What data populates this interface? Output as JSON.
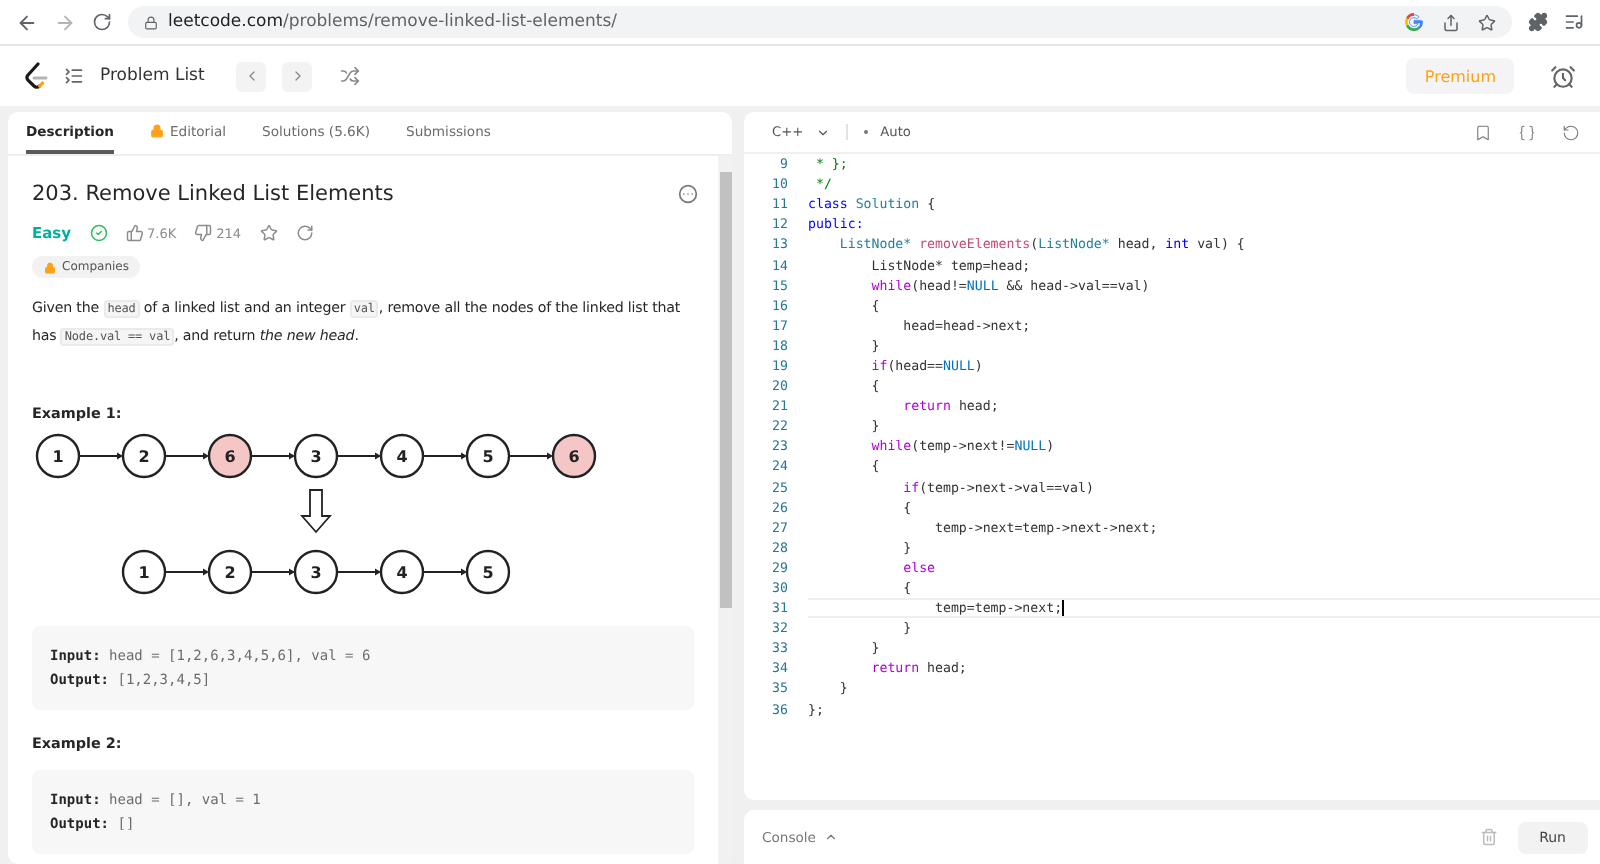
{
  "browser": {
    "url_host": "leetcode.com",
    "url_path": "/problems/remove-linked-list-elements/"
  },
  "header": {
    "title": "Problem List",
    "premium": "Premium"
  },
  "tabs": [
    {
      "label": "Description",
      "selected": true,
      "locked": false
    },
    {
      "label": "Editorial",
      "selected": false,
      "locked": true
    },
    {
      "label": "Solutions (5.6K)",
      "selected": false,
      "locked": false
    },
    {
      "label": "Submissions",
      "selected": false,
      "locked": false
    }
  ],
  "problem": {
    "title": "203. Remove Linked List Elements",
    "difficulty": "Easy",
    "solved": true,
    "likes": "7.6K",
    "dislikes": "214",
    "tag": "Companies",
    "description": [
      {
        "kind": "text",
        "text": "Given the "
      },
      {
        "kind": "code",
        "text": "head"
      },
      {
        "kind": "text",
        "text": " of a linked list and an integer "
      },
      {
        "kind": "code",
        "text": "val"
      },
      {
        "kind": "text",
        "text": ", remove all the nodes of the linked list that has "
      },
      {
        "kind": "code",
        "text": "Node.val == val"
      },
      {
        "kind": "text",
        "text": ", and return "
      },
      {
        "kind": "italic",
        "text": "the new head"
      },
      {
        "kind": "text",
        "text": "."
      }
    ],
    "examples": [
      {
        "title": "Example 1:",
        "diagram": {
          "before": [
            {
              "value": "1",
              "removed": false
            },
            {
              "value": "2",
              "removed": false
            },
            {
              "value": "6",
              "removed": true
            },
            {
              "value": "3",
              "removed": false
            },
            {
              "value": "4",
              "removed": false
            },
            {
              "value": "5",
              "removed": false
            },
            {
              "value": "6",
              "removed": true
            }
          ],
          "after": [
            {
              "value": "1",
              "removed": false
            },
            {
              "value": "2",
              "removed": false
            },
            {
              "value": "3",
              "removed": false
            },
            {
              "value": "4",
              "removed": false
            },
            {
              "value": "5",
              "removed": false
            }
          ]
        },
        "lines": [
          {
            "label": "Input:",
            "value": "head = [1,2,6,3,4,5,6], val = 6"
          },
          {
            "label": "Output:",
            "value": "[1,2,3,4,5]"
          }
        ]
      },
      {
        "title": "Example 2:",
        "lines": [
          {
            "label": "Input:",
            "value": "head = [], val = 1"
          },
          {
            "label": "Output:",
            "value": "[]"
          }
        ]
      }
    ]
  },
  "editor": {
    "language": "C++",
    "mode": "Auto",
    "lines": [
      {
        "number": "9",
        "current": false,
        "tokens": [
          {
            "kind": "comment",
            "text": " * };"
          }
        ]
      },
      {
        "number": "10",
        "current": false,
        "tokens": [
          {
            "kind": "comment",
            "text": " */"
          }
        ]
      },
      {
        "number": "11",
        "current": false,
        "tokens": [
          {
            "kind": "keyword",
            "text": "class"
          },
          {
            "kind": "type",
            "text": " Solution"
          },
          {
            "kind": "plain",
            "text": " {"
          }
        ]
      },
      {
        "number": "12",
        "current": false,
        "tokens": [
          {
            "kind": "keyword",
            "text": "public:"
          }
        ]
      },
      {
        "number": "13",
        "current": false,
        "tokens": [
          {
            "kind": "type",
            "text": "    ListNode*"
          },
          {
            "kind": "func",
            "text": " removeElements"
          },
          {
            "kind": "plain",
            "text": "("
          },
          {
            "kind": "type",
            "text": "ListNode*"
          },
          {
            "kind": "plain",
            "text": " head, "
          },
          {
            "kind": "keyword",
            "text": "int"
          },
          {
            "kind": "plain",
            "text": " val) {"
          }
        ]
      },
      {
        "number": "14",
        "current": false,
        "tokens": [
          {
            "kind": "plain",
            "text": "        ListNode* temp=head;"
          }
        ]
      },
      {
        "number": "15",
        "current": false,
        "tokens": [
          {
            "kind": "control",
            "text": "        while"
          },
          {
            "kind": "plain",
            "text": "(head!="
          },
          {
            "kind": "const",
            "text": "NULL"
          },
          {
            "kind": "plain",
            "text": " && head->val==val)"
          }
        ]
      },
      {
        "number": "16",
        "current": false,
        "tokens": [
          {
            "kind": "plain",
            "text": "        {"
          }
        ]
      },
      {
        "number": "17",
        "current": false,
        "tokens": [
          {
            "kind": "plain",
            "text": "            head=head->next;"
          }
        ]
      },
      {
        "number": "18",
        "current": false,
        "tokens": [
          {
            "kind": "plain",
            "text": "        }"
          }
        ]
      },
      {
        "number": "19",
        "current": false,
        "tokens": [
          {
            "kind": "control",
            "text": "        if"
          },
          {
            "kind": "plain",
            "text": "(head=="
          },
          {
            "kind": "const",
            "text": "NULL"
          },
          {
            "kind": "plain",
            "text": ")"
          }
        ]
      },
      {
        "number": "20",
        "current": false,
        "tokens": [
          {
            "kind": "plain",
            "text": "        {"
          }
        ]
      },
      {
        "number": "21",
        "current": false,
        "tokens": [
          {
            "kind": "control",
            "text": "            return"
          },
          {
            "kind": "plain",
            "text": " head;"
          }
        ]
      },
      {
        "number": "22",
        "current": false,
        "tokens": [
          {
            "kind": "plain",
            "text": "        }"
          }
        ]
      },
      {
        "number": "23",
        "current": false,
        "tokens": [
          {
            "kind": "control",
            "text": "        while"
          },
          {
            "kind": "plain",
            "text": "(temp->next!="
          },
          {
            "kind": "const",
            "text": "NULL"
          },
          {
            "kind": "plain",
            "text": ")"
          }
        ]
      },
      {
        "number": "24",
        "current": false,
        "tokens": [
          {
            "kind": "plain",
            "text": "        {"
          }
        ]
      },
      {
        "number": "25",
        "current": false,
        "tokens": [
          {
            "kind": "control",
            "text": "            if"
          },
          {
            "kind": "plain",
            "text": "(temp->next->val==val)"
          }
        ]
      },
      {
        "number": "26",
        "current": false,
        "tokens": [
          {
            "kind": "plain",
            "text": "            {"
          }
        ]
      },
      {
        "number": "27",
        "current": false,
        "tokens": [
          {
            "kind": "plain",
            "text": "                temp->next=temp->next->next;"
          }
        ]
      },
      {
        "number": "28",
        "current": false,
        "tokens": [
          {
            "kind": "plain",
            "text": "            }"
          }
        ]
      },
      {
        "number": "29",
        "current": false,
        "tokens": [
          {
            "kind": "control",
            "text": "            else"
          }
        ]
      },
      {
        "number": "30",
        "current": false,
        "tokens": [
          {
            "kind": "plain",
            "text": "            {"
          }
        ]
      },
      {
        "number": "31",
        "current": true,
        "tokens": [
          {
            "kind": "plain",
            "text": "                temp=temp->next;"
          }
        ]
      },
      {
        "number": "32",
        "current": false,
        "tokens": [
          {
            "kind": "plain",
            "text": "            }"
          }
        ]
      },
      {
        "number": "33",
        "current": false,
        "tokens": [
          {
            "kind": "plain",
            "text": "        }"
          }
        ]
      },
      {
        "number": "34",
        "current": false,
        "tokens": [
          {
            "kind": "control",
            "text": "        return"
          },
          {
            "kind": "plain",
            "text": " head;"
          }
        ]
      },
      {
        "number": "35",
        "current": false,
        "tokens": [
          {
            "kind": "plain",
            "text": "    }"
          }
        ]
      },
      {
        "number": "36",
        "current": false,
        "tokens": [
          {
            "kind": "plain",
            "text": "};"
          }
        ]
      }
    ]
  },
  "console": {
    "label": "Console",
    "run": "Run"
  }
}
